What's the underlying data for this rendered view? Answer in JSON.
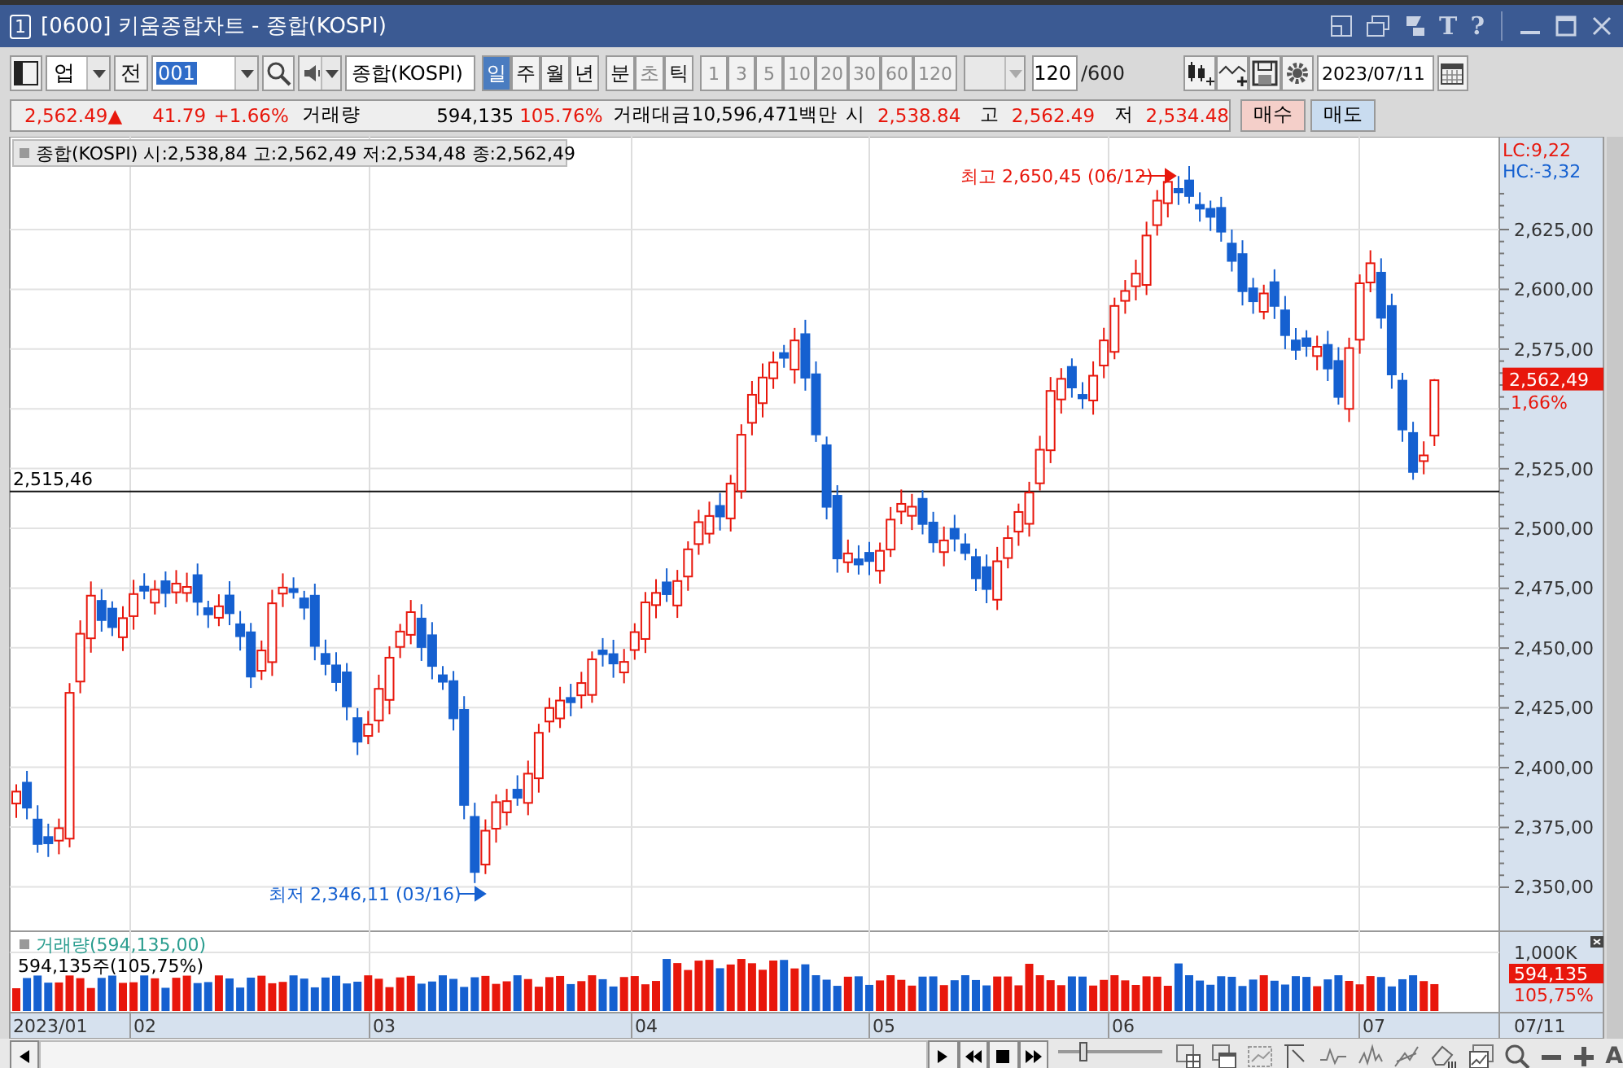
{
  "window": {
    "number": "1",
    "title": "[0600] 키움종합차트 - 종합(KOSPI)",
    "title_buttons": [
      "T",
      "?"
    ]
  },
  "toolbar": {
    "market": "업",
    "all_button": "전",
    "code": "001",
    "name": "종합(KOSPI)",
    "periods": [
      {
        "label": "일",
        "selected": true
      },
      {
        "label": "주",
        "selected": false
      },
      {
        "label": "월",
        "selected": false
      },
      {
        "label": "년",
        "selected": false
      }
    ],
    "units": [
      {
        "label": "분",
        "disabled": false
      },
      {
        "label": "초",
        "disabled": true
      },
      {
        "label": "틱",
        "disabled": false
      }
    ],
    "minutes": [
      {
        "label": "1",
        "disabled": true
      },
      {
        "label": "3",
        "disabled": true
      },
      {
        "label": "5",
        "disabled": true
      },
      {
        "label": "10",
        "disabled": true
      },
      {
        "label": "20",
        "disabled": true
      },
      {
        "label": "30",
        "disabled": true
      },
      {
        "label": "60",
        "disabled": true
      },
      {
        "label": "120",
        "disabled": true
      }
    ],
    "count": "120",
    "total": "/600",
    "date": "2023/07/11"
  },
  "quote": {
    "price": "2,562.49",
    "arrow": "▲",
    "change": "41.79",
    "change_pct": "+1.66%",
    "volume_label": "거래량",
    "volume": "594,135",
    "volume_pct": "105.76%",
    "value_label": "거래대금",
    "value": "10,596,471백만",
    "open_label": "시",
    "open": "2,538.84",
    "high_label": "고",
    "high": "2,562.49",
    "low_label": "저",
    "low": "2,534.48",
    "buy": "매수",
    "sell": "매도"
  },
  "chart": {
    "legend": "종합(KOSPI) 시:2,538,84 고:2,562,49 저:2,534,48 종:2,562,49",
    "lc": "LC:9,22",
    "hc": "HC:-3,32",
    "y_axis_labels": [
      "2,625,00",
      "2,600,00",
      "2,575,00",
      "2,525,00",
      "2,500,00",
      "2,475,00",
      "2,450,00",
      "2,425,00",
      "2,400,00",
      "2,375,00",
      "2,350,00"
    ],
    "price_tag": "2,562,49",
    "price_pct": "1,66%",
    "line_label": "2,515,46",
    "high_note": "최고 2,650,45 (06/12)",
    "low_note": "최저 2,346,11 (03/16)"
  },
  "volume": {
    "legend": "거래량(594,135,00)",
    "reading": "594,135주(105,75%)",
    "axis_label": "1,000K",
    "tag": "594,135",
    "tag_pct": "105,75%"
  },
  "x_axis": {
    "labels": [
      "2023/01",
      "02",
      "03",
      "04",
      "05",
      "06",
      "07"
    ],
    "end_label": "07/11"
  },
  "bottom": {
    "zoom_slider": {
      "level": 0.2
    },
    "font_button": "A"
  }
}
